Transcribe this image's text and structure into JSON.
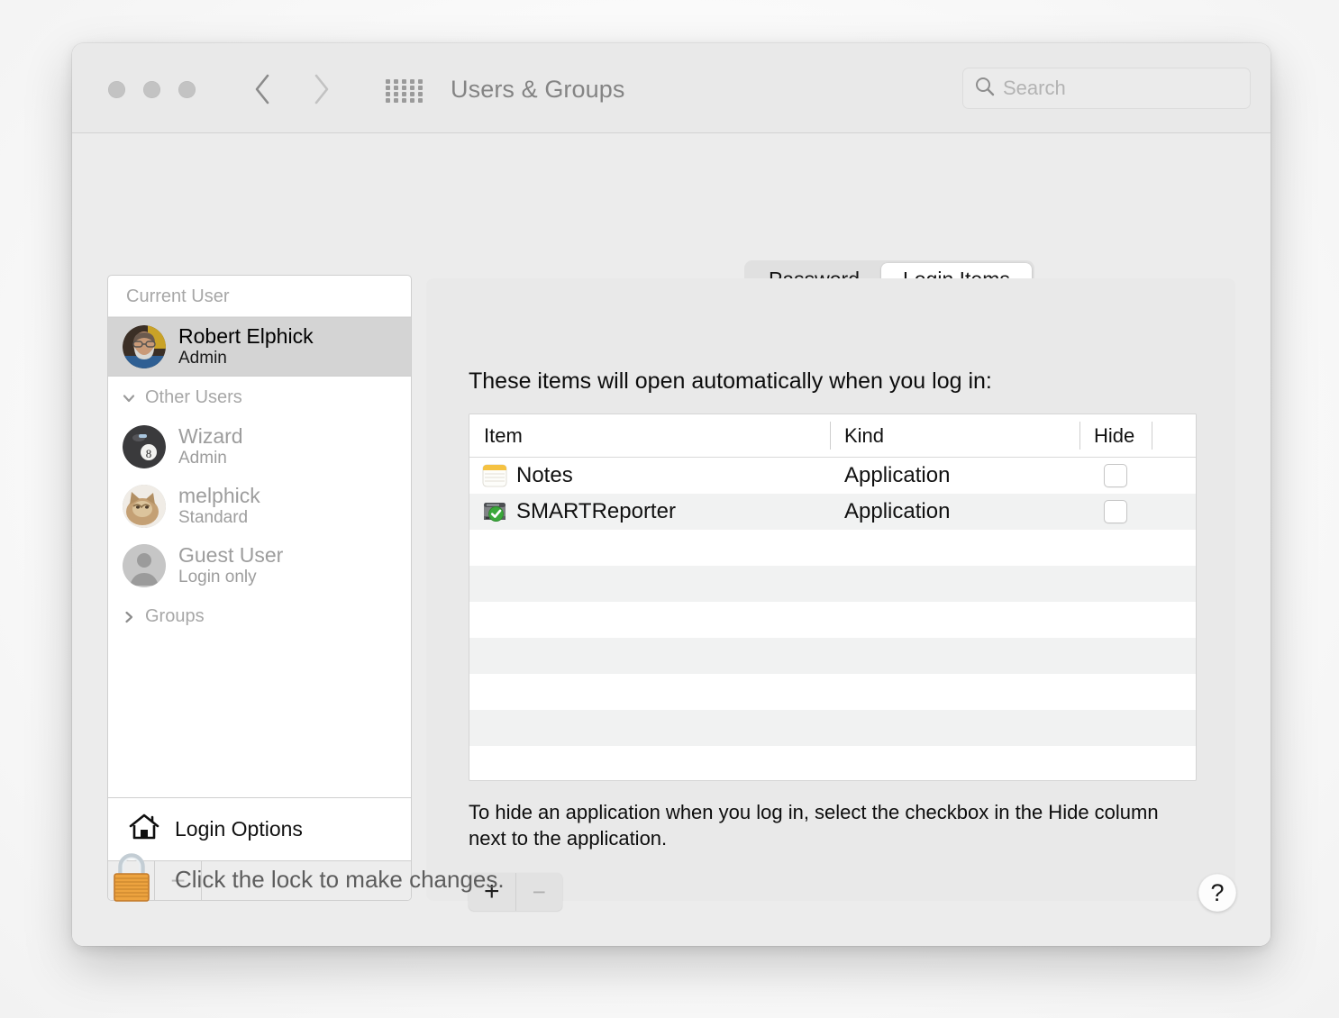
{
  "window": {
    "title": "Users & Groups",
    "traffic_lights": [
      "close",
      "minimize",
      "zoom"
    ],
    "nav": {
      "back": "back-chevron",
      "forward": "forward-chevron",
      "show_all": "grid-icon"
    }
  },
  "search": {
    "placeholder": "Search",
    "icon": "search-icon",
    "value": ""
  },
  "sidebar": {
    "current_user_header": "Current User",
    "current_user": {
      "name": "Robert Elphick",
      "role": "Admin",
      "avatar": "photo-bearded-man"
    },
    "other_users_header": "Other Users",
    "other_users": [
      {
        "name": "Wizard",
        "role": "Admin",
        "avatar": "eight-ball"
      },
      {
        "name": "melphick",
        "role": "Standard",
        "avatar": "photo-cat"
      },
      {
        "name": "Guest User",
        "role": "Login only",
        "avatar": "person-silhouette"
      }
    ],
    "groups_header": "Groups",
    "login_options": {
      "label": "Login Options",
      "icon": "home-icon"
    },
    "footer_buttons": {
      "add": "+",
      "remove": "−"
    }
  },
  "tabs": [
    {
      "label": "Password",
      "active": false
    },
    {
      "label": "Login Items",
      "active": true
    }
  ],
  "main": {
    "heading": "These items will open automatically when you log in:",
    "columns": [
      "Item",
      "Kind",
      "Hide"
    ],
    "rows": [
      {
        "item": "Notes",
        "kind": "Application",
        "hide": false,
        "icon": "notes-app-icon"
      },
      {
        "item": "SMARTReporter",
        "kind": "Application",
        "hide": false,
        "icon": "smartreporter-app-icon"
      }
    ],
    "empty_row_count": 8,
    "help_text": "To hide an application when you log in, select the checkbox in the Hide column next to the application.",
    "add_button": "+",
    "remove_button": "−"
  },
  "footer": {
    "lock_text": "Click the lock to make changes.",
    "lock_icon": "closed-padlock-icon",
    "help_button": "?"
  },
  "colors": {
    "window_bg": "#ececec",
    "panel_bg": "#e9e9e9",
    "selection": "#d4d4d4",
    "stripe": "#f1f2f2",
    "lock_gold": "#e9a13b"
  }
}
